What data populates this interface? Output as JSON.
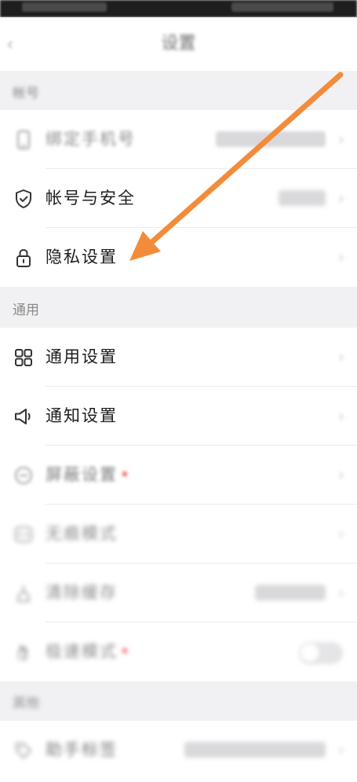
{
  "header": {
    "title": "设置",
    "back_glyph": "‹"
  },
  "sections": {
    "account": {
      "header": "帐号",
      "items": [
        {
          "label": "绑定手机号",
          "value": "1*********"
        },
        {
          "label": "帐号与安全",
          "value": "已保护"
        },
        {
          "label": "隐私设置",
          "value": ""
        }
      ]
    },
    "general": {
      "header": "通用",
      "items": [
        {
          "label": "通用设置"
        },
        {
          "label": "通知设置"
        },
        {
          "label": "屏蔽设置"
        },
        {
          "label": "无痕模式"
        },
        {
          "label": "清除缓存",
          "value": "171.2MB"
        },
        {
          "label": "极速模式"
        }
      ]
    },
    "other": {
      "header": "其他",
      "items": [
        {
          "label": "助手标签",
          "value": ""
        }
      ]
    }
  },
  "chevron": "›",
  "colors": {
    "arrow": "#f28c3a",
    "red_dot": "#f04a4a",
    "section_bg": "#f1f1f3"
  }
}
